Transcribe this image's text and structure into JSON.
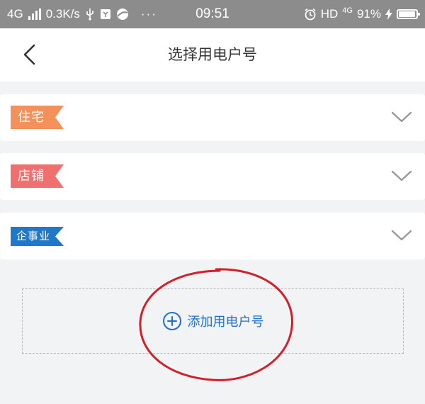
{
  "status_bar": {
    "network": "4G",
    "speed": "0.3K/s",
    "dots": "···",
    "time": "09:51",
    "hd": "HD",
    "network_right": "4G",
    "battery": "91%"
  },
  "nav": {
    "title": "选择用电户号"
  },
  "categories": [
    {
      "label": "住宅",
      "color": "#f4915a"
    },
    {
      "label": "店铺",
      "color": "#f06f6f"
    },
    {
      "label": "企事业",
      "color": "#1f78c8"
    }
  ],
  "add_account": {
    "label": "添加用电户号",
    "accent": "#1f6fd0"
  },
  "annotation_color": "#d0202a"
}
